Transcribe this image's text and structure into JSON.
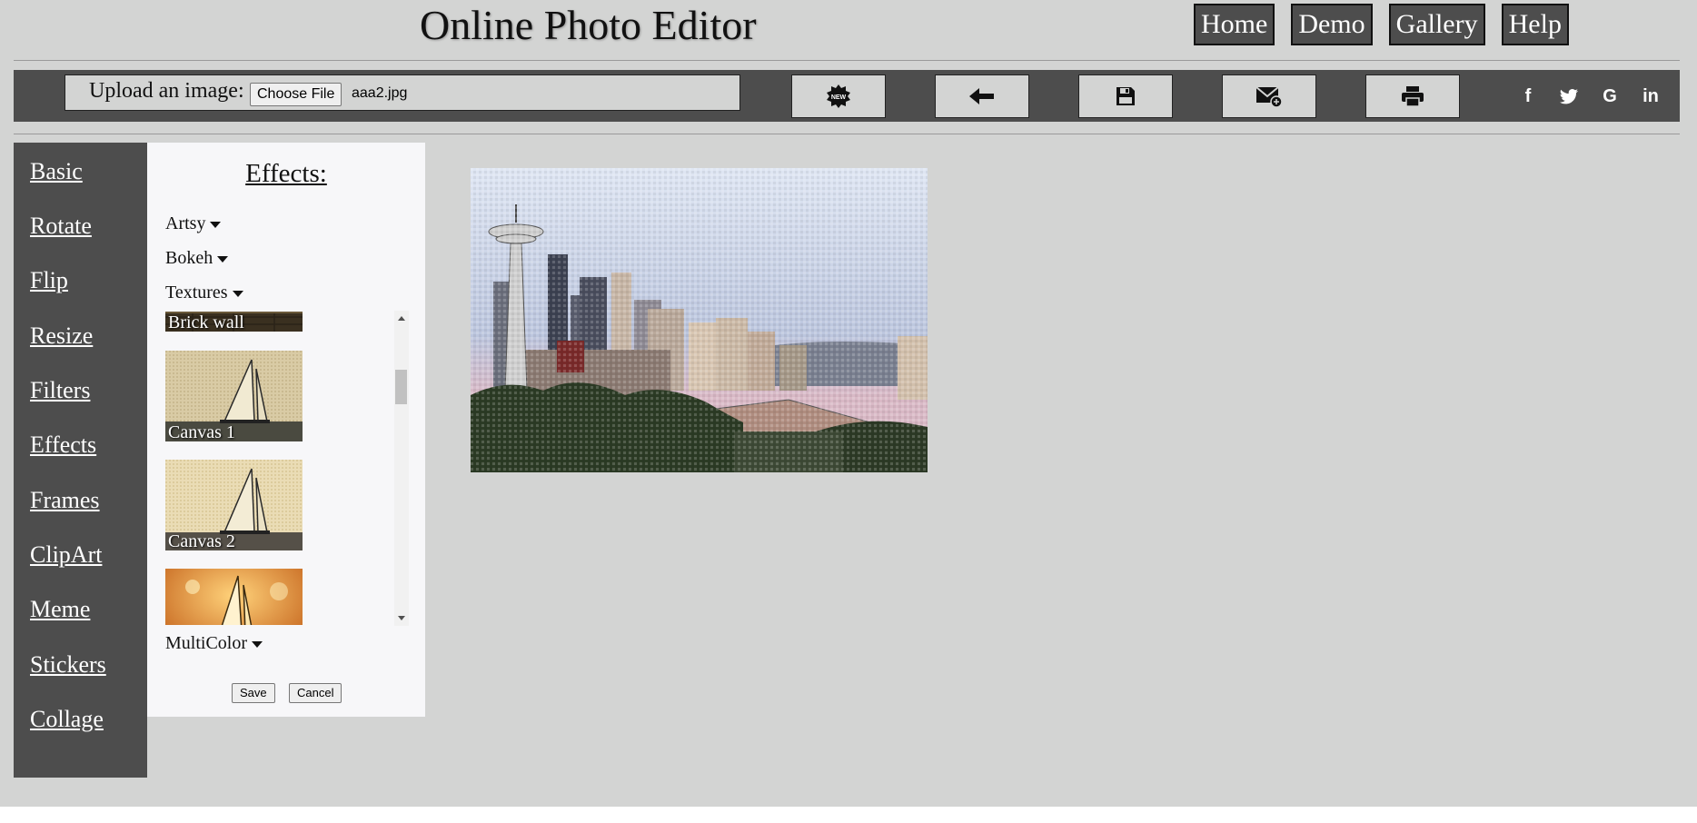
{
  "header": {
    "title": "Online Photo Editor",
    "nav": [
      "Home",
      "Demo",
      "Gallery",
      "Help"
    ]
  },
  "toolbar": {
    "upload_label": "Upload an image:",
    "choose_file": "Choose File",
    "file_name": "aaa2.jpg",
    "tools": [
      "new-icon",
      "undo-arrow-icon",
      "save-disk-icon",
      "email-icon",
      "print-icon"
    ],
    "social": [
      "f",
      "twitter-icon",
      "G",
      "in"
    ]
  },
  "sidebar": {
    "items": [
      "Basic",
      "Rotate",
      "Flip",
      "Resize",
      "Filters",
      "Effects",
      "Frames",
      "ClipArt",
      "Meme",
      "Stickers",
      "Collage"
    ]
  },
  "effects_panel": {
    "title": "Effects:",
    "categories": [
      "Artsy",
      "Bokeh",
      "Textures",
      "MultiColor"
    ],
    "thumbnails": [
      "Brick wall",
      "Canvas 1",
      "Canvas 2",
      ""
    ],
    "save": "Save",
    "cancel": "Cancel"
  },
  "colors": {
    "background": "#d3d4d3",
    "dark": "#4d4d4d",
    "panel": "#f7f7f9"
  }
}
